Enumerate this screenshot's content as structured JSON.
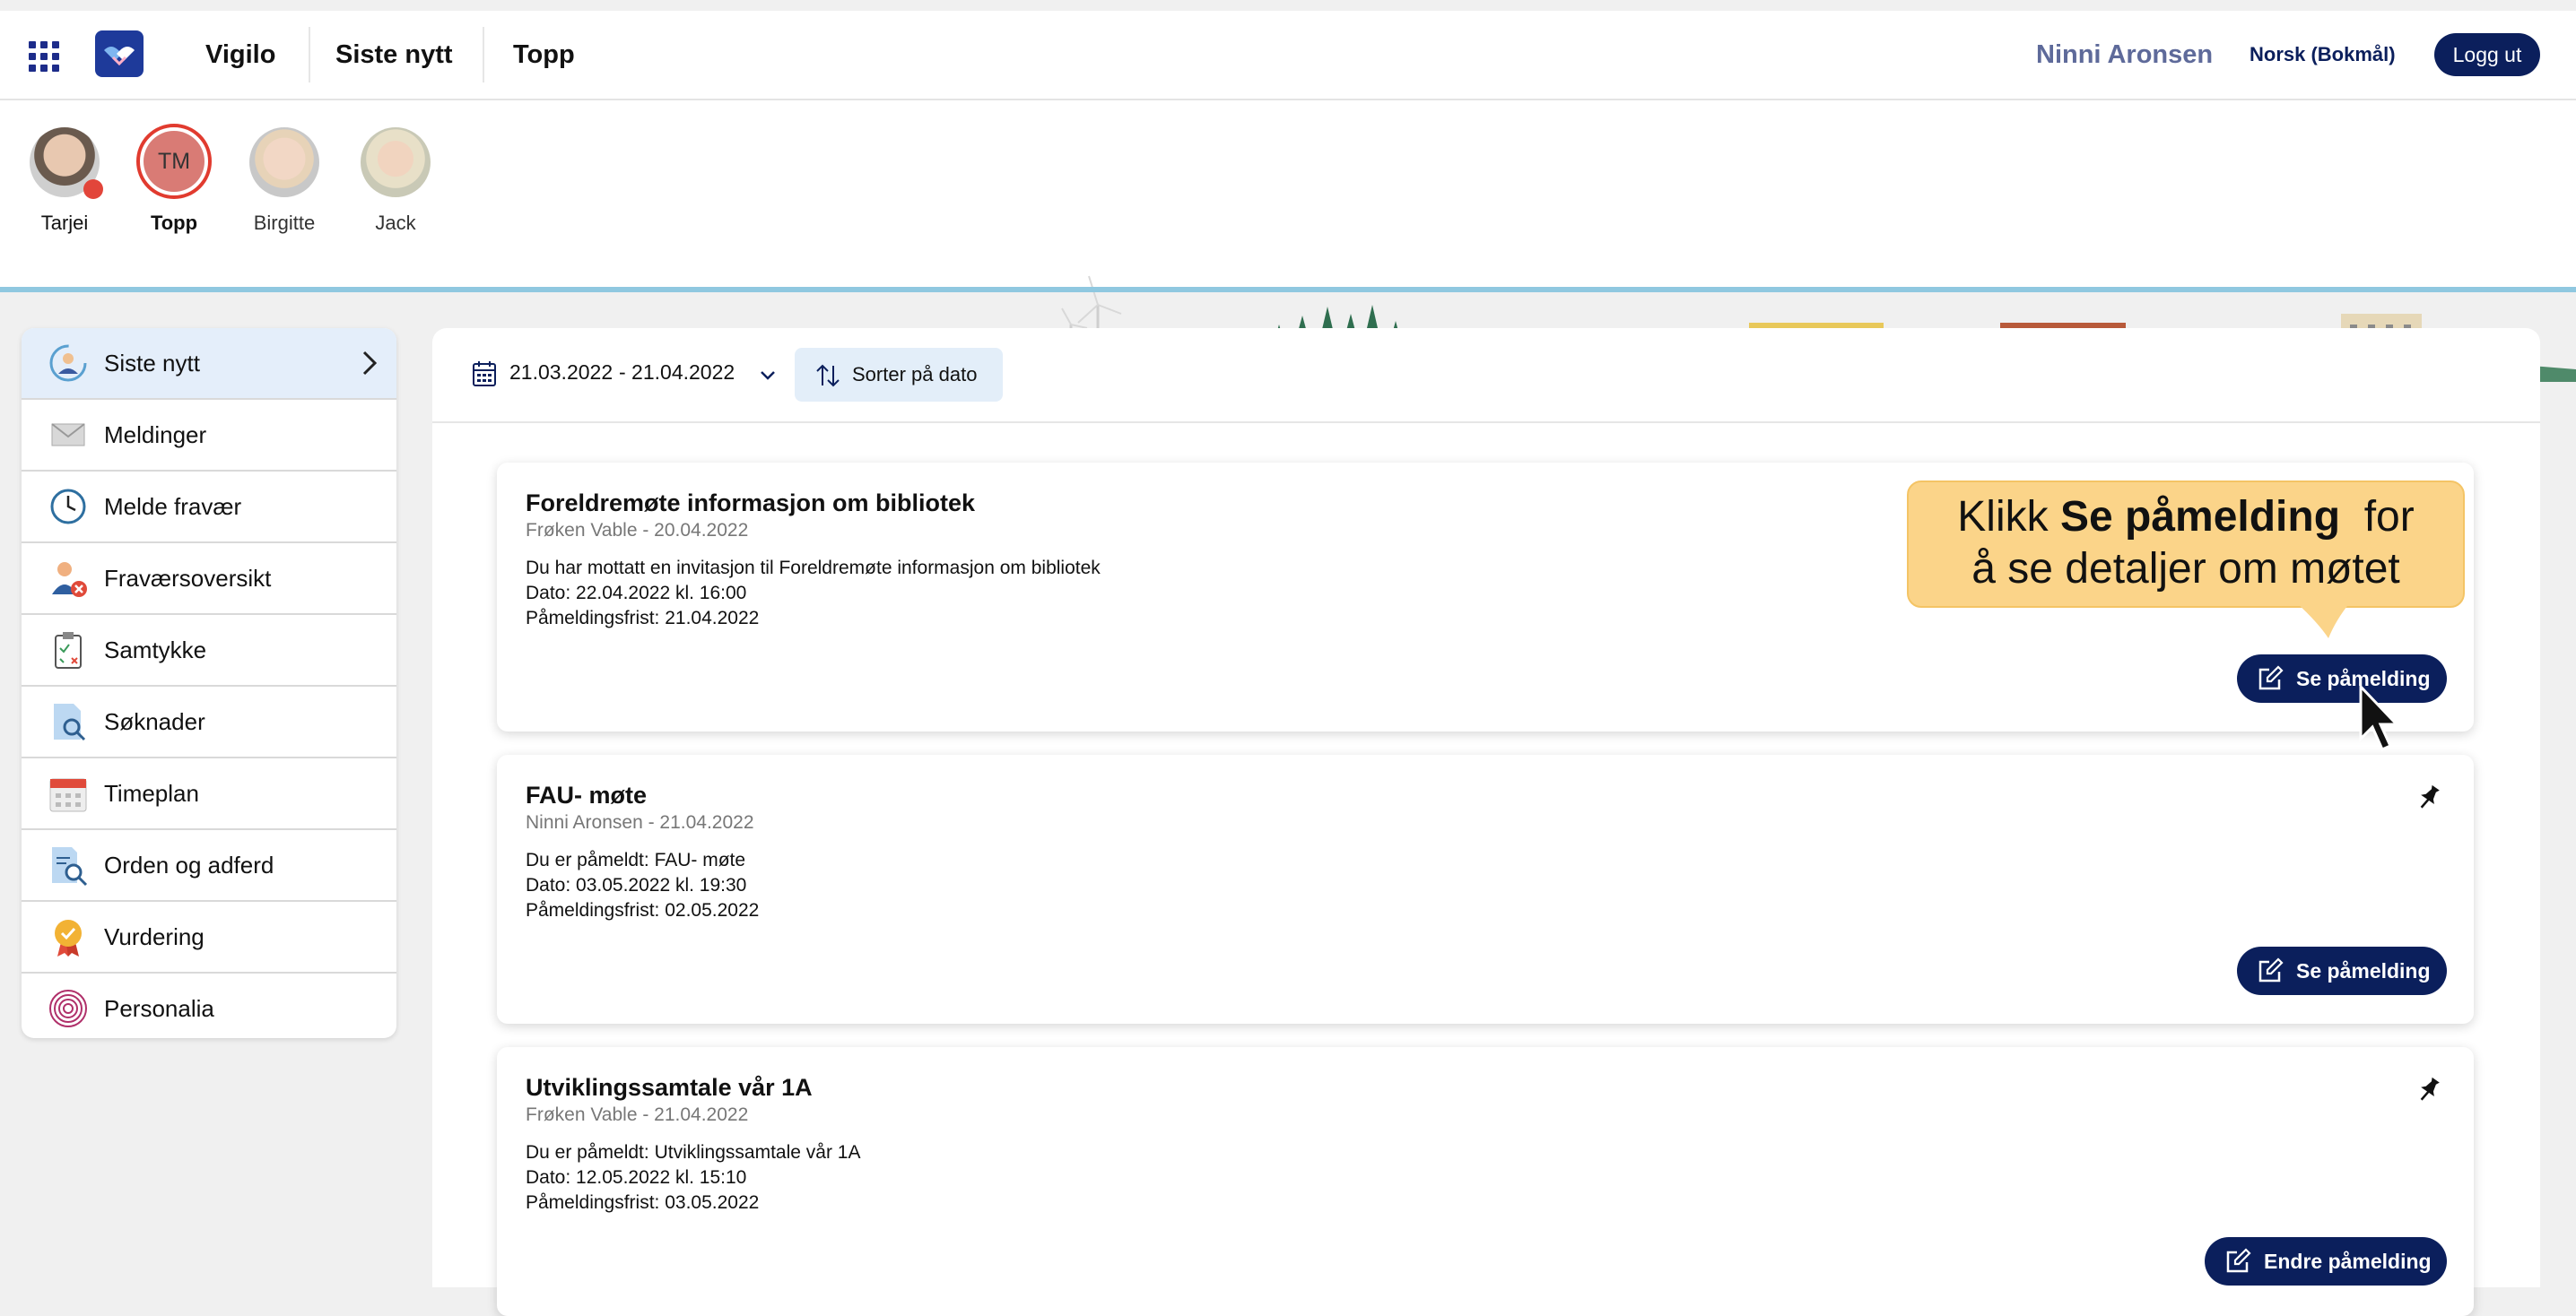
{
  "topbar": {
    "app_menu_icon": "apps-grid-icon",
    "logo_icon": "vigilo-logo-icon",
    "nav": [
      "Vigilo",
      "Siste nytt",
      "Topp"
    ],
    "user_name": "Ninni Aronsen",
    "language": "Norsk (Bokmål)",
    "logout": "Logg ut"
  },
  "children": [
    {
      "name": "Tarjei",
      "photo": true,
      "notification": true
    },
    {
      "name": "Topp",
      "initials": "TM",
      "selected": true
    },
    {
      "name": "Birgitte",
      "photo": true
    },
    {
      "name": "Jack",
      "photo": true
    }
  ],
  "sidebar": {
    "items": [
      {
        "label": "Siste nytt",
        "icon": "news-person-icon",
        "active": true
      },
      {
        "label": "Meldinger",
        "icon": "envelope-icon"
      },
      {
        "label": "Melde fravær",
        "icon": "clock-icon"
      },
      {
        "label": "Fraværsoversikt",
        "icon": "person-absence-icon"
      },
      {
        "label": "Samtykke",
        "icon": "clipboard-icon"
      },
      {
        "label": "Søknader",
        "icon": "document-search-icon"
      },
      {
        "label": "Timeplan",
        "icon": "calendar-icon"
      },
      {
        "label": "Orden og adferd",
        "icon": "report-search-icon"
      },
      {
        "label": "Vurdering",
        "icon": "medal-icon"
      },
      {
        "label": "Personalia",
        "icon": "fingerprint-icon"
      }
    ]
  },
  "filter": {
    "date_from": "21.03.2022",
    "date_to": "- 21.04.2022",
    "sort_label": "Sorter på dato"
  },
  "cards": [
    {
      "title": "Foreldremøte informasjon om bibliotek",
      "author_date": "Frøken Vable - 20.04.2022",
      "lines": [
        "Du har mottatt en invitasjon til Foreldremøte informasjon om bibliotek",
        "Dato: 22.04.2022 kl. 16:00",
        "Påmeldingsfrist: 21.04.2022"
      ],
      "button": "Se påmelding",
      "pinned": false
    },
    {
      "title": "FAU- møte",
      "author_date": "Ninni Aronsen - 21.04.2022",
      "lines": [
        "Du er påmeldt: FAU- møte",
        "Dato: 03.05.2022 kl. 19:30",
        "Påmeldingsfrist: 02.05.2022"
      ],
      "button": "Se påmelding",
      "pinned": true
    },
    {
      "title": "Utviklingssamtale vår 1A",
      "author_date": "Frøken Vable - 21.04.2022",
      "lines": [
        "Du er påmeldt: Utviklingssamtale vår 1A",
        "Dato: 12.05.2022 kl. 15:10",
        "Påmeldingsfrist: 03.05.2022"
      ],
      "button": "Endre påmelding",
      "pinned": true
    }
  ],
  "callout": {
    "part1": "Klikk ",
    "bold": "Se påmelding",
    "part2": "  for",
    "line2": "å se detaljer om møtet"
  },
  "colors": {
    "navy": "#0b1f5c",
    "callout": "#fbd489",
    "active_item": "#e4eefa"
  }
}
